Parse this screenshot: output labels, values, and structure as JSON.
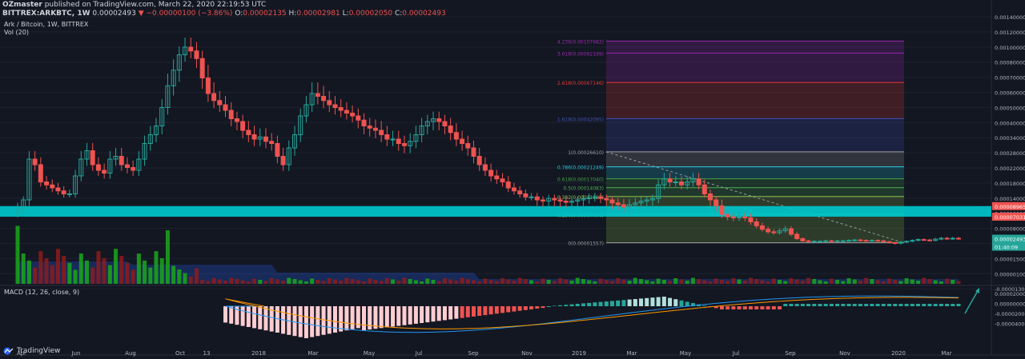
{
  "header": {
    "author": "OZmaster",
    "published": "published on TradingView.com, March 22, 2020 22:19:53 UTC",
    "symbol": "BITTREX:ARKBTC, 1W",
    "last": "0.00002493",
    "change": "▼ −0.00000100 (−3.86%)",
    "o_label": "O:",
    "o": "0.00002135",
    "h_label": "H:",
    "h": "0.00002981",
    "l_label": "L:",
    "l": "0.00002050",
    "c_label": "C:",
    "c": "0.00002493"
  },
  "legend": {
    "title": "Ark / Bitcoin, 1W, BITTREX",
    "vol": "Vol (20)"
  },
  "macd_legend": "MACD (12, 26, close, 9)",
  "brand": "TradingView",
  "colors": {
    "bg": "#131722",
    "up": "#26a69a",
    "down": "#ef5350",
    "zone": "#00c5cc",
    "vol_up": "#1aa81a",
    "vol_down": "#8e1b1b"
  },
  "chart_data": [
    {
      "type": "candlestick",
      "ylim": [
        0,
        0.0014
      ],
      "yticks": [
        "0.00140000",
        "0.00120000",
        "0.00100000",
        "0.00080000",
        "0.00070000",
        "0.00060000",
        "0.00050000",
        "0.00040000",
        "0.00034000",
        "0.00028000",
        "0.00022000",
        "0.00018000",
        "0.00014000",
        "0.00010000",
        "0.00008000",
        "0.00003500",
        "0.00001500",
        "0.00000100",
        "-0.00001300"
      ],
      "xticks": [
        "Apr",
        "Jun",
        "Aug",
        "Oct",
        "13",
        "2018",
        "Mar",
        "May",
        "Jul",
        "Sep",
        "Nov",
        "2019",
        "Mar",
        "May",
        "Jul",
        "Sep",
        "Nov",
        "2020",
        "Mar"
      ],
      "price_labels": [
        {
          "text": "0.00008965",
          "color": "#ef5350"
        },
        {
          "text": "0.00007031",
          "color": "#ef5350"
        },
        {
          "text": "0.00002493",
          "color": "#26a69a"
        },
        {
          "text": "01:40:09",
          "color": "#26a69a"
        }
      ],
      "fib_levels": [
        {
          "label": "4.236(0.00107682)",
          "price": 0.00107682,
          "color": "#9c27b0"
        },
        {
          "label": "3.618(0.00092199)",
          "price": 0.00092199,
          "color": "#9c27b0"
        },
        {
          "label": "2.618(0.00067146)",
          "price": 0.00067146,
          "color": "#e53935"
        },
        {
          "label": "1.618(0.00042095)",
          "price": 0.00042095,
          "color": "#3f51b5"
        },
        {
          "label": "1(0.00026610)",
          "price": 0.0002661,
          "color": "#9e9e9e"
        },
        {
          "label": "0.786(0.00021249)",
          "price": 0.00021249,
          "color": "#26c6da"
        },
        {
          "label": "0.618(0.00017040)",
          "price": 0.0001704,
          "color": "#43a047"
        },
        {
          "label": "0.5(0.00014083)",
          "price": 0.00014083,
          "color": "#4caf50"
        },
        {
          "label": "0.382(0.00011127)",
          "price": 0.00011127,
          "color": "#8bc34a"
        },
        {
          "label": "0.236(0.00007470)",
          "price": 7.47e-05,
          "color": "#8bc34a"
        },
        {
          "label": "0(0.00001557)",
          "price": 1.557e-05,
          "color": "#9e9e9e"
        }
      ],
      "zone": [
        7.031e-05,
        8.965e-05
      ],
      "closes": [
        8.5e-05,
        0.0001,
        0.00024,
        0.00022,
        0.00016,
        0.00015,
        0.00014,
        0.00013,
        0.00012,
        0.00012,
        0.00018,
        0.00024,
        0.00027,
        0.00022,
        0.0002,
        0.00019,
        0.00024,
        0.00025,
        0.00022,
        0.00021,
        0.0002,
        0.00024,
        0.0003,
        0.00034,
        0.00038,
        0.0005,
        0.00065,
        0.00075,
        0.0009,
        0.001,
        0.00095,
        0.00085,
        0.0007,
        0.0006,
        0.00055,
        0.00052,
        0.00048,
        0.00042,
        0.0004,
        0.00036,
        0.00034,
        0.00032,
        0.00033,
        0.00031,
        0.0003,
        0.00025,
        0.00022,
        0.00028,
        0.00034,
        0.00044,
        0.00052,
        0.0006,
        0.00058,
        0.00055,
        0.00052,
        0.0005,
        0.00048,
        0.00046,
        0.00044,
        0.00041,
        0.00038,
        0.00037,
        0.00036,
        0.00034,
        0.00032,
        0.00032,
        0.0003,
        0.00029,
        0.00031,
        0.00034,
        0.00038,
        0.0004,
        0.00042,
        0.0004,
        0.00038,
        0.00035,
        0.00032,
        0.0003,
        0.00028,
        0.00025,
        0.00022,
        0.0002,
        0.00018,
        0.00017,
        0.00016,
        0.00014,
        0.00013,
        0.00012,
        0.00011,
        0.00011,
        0.0001,
        9.8e-05,
        0.000105,
        0.0001,
        9.8e-05,
        9.6e-05,
        9.8e-05,
        0.0001,
        0.000104,
        0.000108,
        0.00011,
        0.000105,
        0.0001,
        9.5e-05,
        9.2e-05,
        8.8e-05,
        9.2e-05,
        9.5e-05,
        9.8e-05,
        0.0001,
        0.000105,
        0.00015,
        0.00017,
        0.00016,
        0.00016,
        0.00015,
        0.00016,
        0.00017,
        0.00015,
        0.00012,
        0.0001,
        9e-05,
        7.5e-05,
        7e-05,
        6.8e-05,
        7e-05,
        6.8e-05,
        6e-05,
        5.2e-05,
        4.5e-05,
        4e-05,
        3.8e-05,
        4.2e-05,
        4.6e-05,
        3.5e-05,
        2.5e-05,
        2e-05,
        1.9e-05,
        1.9e-05,
        1.9e-05,
        2e-05,
        1.9e-05,
        2e-05,
        2e-05,
        2.1e-05,
        2.2e-05,
        2.1e-05,
        2e-05,
        2.1e-05,
        2e-05,
        1.8e-05,
        1.6e-05,
        1.5e-05,
        1.7e-05,
        1.9e-05,
        2.1e-05,
        2.3e-05,
        2.2e-05,
        2.1e-05,
        2.4e-05,
        2.6e-05,
        2.5e-05,
        2.59e-05,
        2.493e-05
      ]
    }
  ]
}
